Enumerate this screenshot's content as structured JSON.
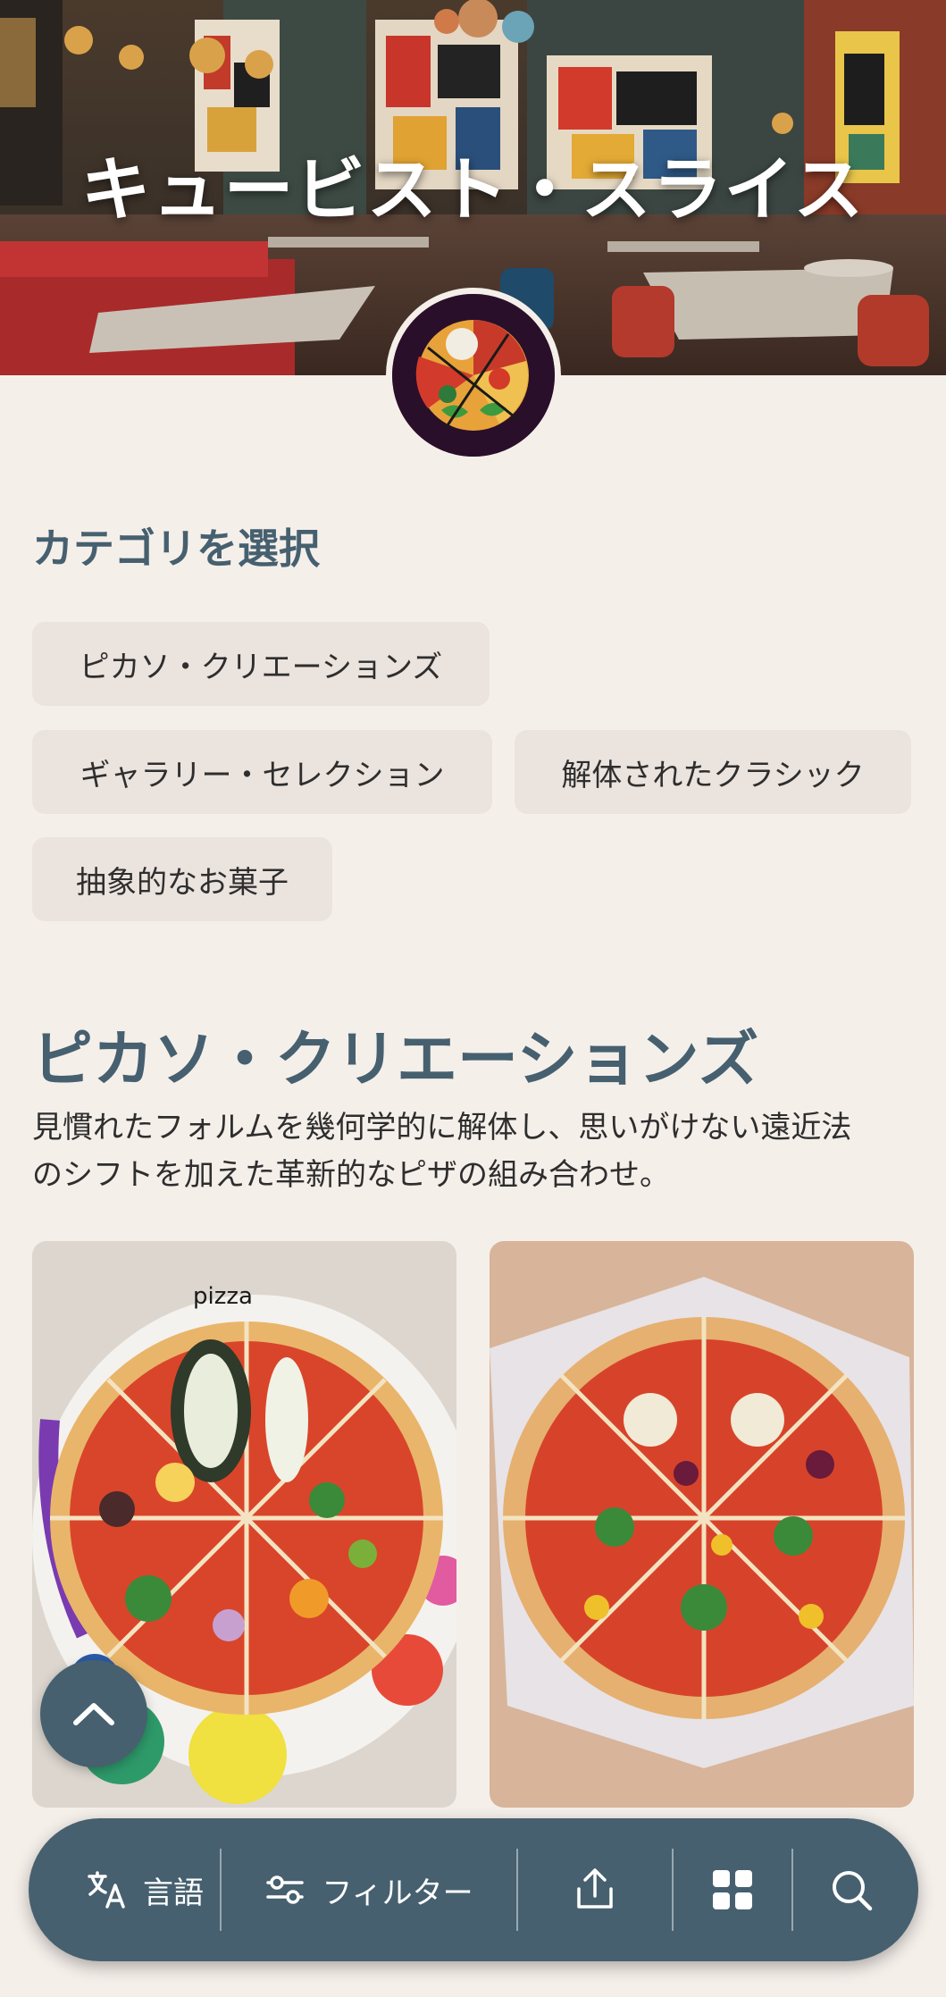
{
  "hero": {
    "title": "キュービスト・スライス"
  },
  "categories": {
    "heading": "カテゴリを選択",
    "chips": [
      "ピカソ・クリエーションズ",
      "ギャラリー・セレクション",
      "解体されたクラシック",
      "抽象的なお菓子"
    ]
  },
  "section": {
    "title": "ピカソ・クリエーションズ",
    "description_line1": "見慣れたフォルムを幾何学的に解体し、思いがけない遠近法",
    "description_line2": "のシフトを加えた革新的なピザの組み合わせ。"
  },
  "cards": [
    {
      "plate_text": "pizza",
      "image": "pizza-on-palette-plate"
    },
    {
      "image": "pizza-on-paper-box"
    }
  ],
  "bottom_bar": {
    "language_label": "言語",
    "filter_label": "フィルター",
    "icons": [
      "translate-icon",
      "filter-icon",
      "share-icon",
      "grid-icon",
      "search-icon"
    ]
  },
  "colors": {
    "background": "#f5efea",
    "accent": "#46606f",
    "chip_bg": "#ebe3de"
  }
}
